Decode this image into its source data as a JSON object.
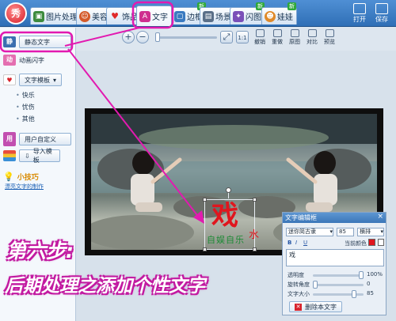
{
  "app": {
    "logo_text": "秀"
  },
  "tabs": [
    {
      "label": "图片处理",
      "icon": "image-icon",
      "new": ""
    },
    {
      "label": "美容",
      "icon": "face-icon",
      "new": ""
    },
    {
      "label": "饰品",
      "icon": "heart-icon",
      "new": ""
    },
    {
      "label": "文字",
      "icon": "text-a-icon",
      "new": ""
    },
    {
      "label": "边框",
      "icon": "frame-icon",
      "new": "新"
    },
    {
      "label": "场景",
      "icon": "scene-icon",
      "new": ""
    },
    {
      "label": "闪图",
      "icon": "flash-icon",
      "new": "新"
    },
    {
      "label": "娃娃",
      "icon": "doll-icon",
      "new": "新"
    }
  ],
  "top_actions": {
    "open": "打开",
    "save": "保存"
  },
  "left_panel": {
    "static_text": "静态文字",
    "animated_text": "动画闪字",
    "text_template": "文字模板",
    "template_items": [
      "快乐",
      "忧伤",
      "其他"
    ],
    "custom": "用户自定义",
    "import_template": "导入模板",
    "tip_title": "小技巧",
    "tip_link": "漂亮文字的制作"
  },
  "toolbar": {
    "zoom_in": "+",
    "zoom_out": "−",
    "tools": [
      "撤销",
      "重做",
      "原图",
      "对比",
      "预览"
    ]
  },
  "canvas_text": {
    "main": "戏",
    "sub": "自娱自乐",
    "small": "水"
  },
  "editor": {
    "title": "文字编辑框",
    "font": "迷你简古隶",
    "size": "85",
    "direction": "横排",
    "bold": "B",
    "italic": "I",
    "underline": "U",
    "color_label": "当前颜色",
    "content": "戏",
    "opacity_label": "透明度",
    "opacity_value": "100%",
    "rotate_label": "旋转角度",
    "rotate_value": "0",
    "size_label": "文字大小",
    "size_value": "85",
    "delete_button": "删除本文字",
    "levels": {
      "opacity": 1.0,
      "rotate": 0.0,
      "size": 0.85
    }
  },
  "overlay": {
    "step_title": "第六步:",
    "step_subtitle": "后期处理之添加个性文字"
  },
  "colors": {
    "accent": "#c21aa1",
    "text_red": "#e0161e",
    "text_green": "#1c8a35"
  }
}
